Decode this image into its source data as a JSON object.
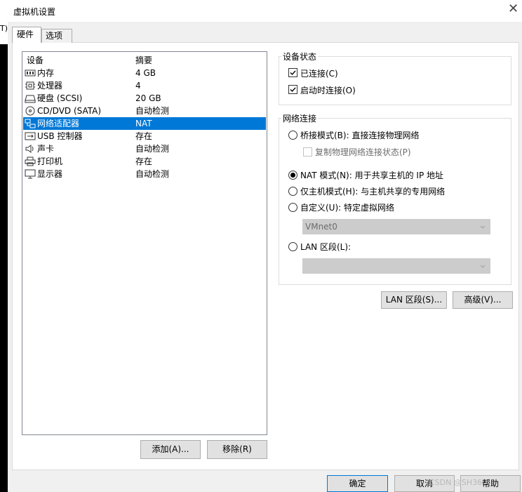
{
  "window": {
    "title": "虚拟机设置",
    "close_glyph": "✕",
    "edge_text": "T)"
  },
  "tabs": [
    {
      "label": "硬件",
      "active": true
    },
    {
      "label": "选项",
      "active": false
    }
  ],
  "device_list": {
    "header_device": "设备",
    "header_summary": "摘要",
    "rows": [
      {
        "name": "内存",
        "summary": "4 GB",
        "icon": "memory-icon",
        "selected": false
      },
      {
        "name": "处理器",
        "summary": "4",
        "icon": "cpu-icon",
        "selected": false
      },
      {
        "name": "硬盘 (SCSI)",
        "summary": "20 GB",
        "icon": "hard-disk-icon",
        "selected": false
      },
      {
        "name": "CD/DVD (SATA)",
        "summary": "自动检测",
        "icon": "cd-dvd-icon",
        "selected": false
      },
      {
        "name": "网络适配器",
        "summary": "NAT",
        "icon": "network-adapter-icon",
        "selected": true
      },
      {
        "name": "USB 控制器",
        "summary": "存在",
        "icon": "usb-icon",
        "selected": false
      },
      {
        "name": "声卡",
        "summary": "自动检测",
        "icon": "speaker-icon",
        "selected": false
      },
      {
        "name": "打印机",
        "summary": "存在",
        "icon": "printer-icon",
        "selected": false
      },
      {
        "name": "显示器",
        "summary": "自动检测",
        "icon": "monitor-icon",
        "selected": false
      }
    ]
  },
  "left_buttons": {
    "add": "添加(A)...",
    "remove": "移除(R)"
  },
  "device_status": {
    "title": "设备状态",
    "connected": {
      "label": "已连接(C)",
      "checked": true
    },
    "connect_at_power_on": {
      "label": "启动时连接(O)",
      "checked": true
    }
  },
  "network_connection": {
    "title": "网络连接",
    "bridged": {
      "label": "桥接模式(B): 直接连接物理网络",
      "selected": false
    },
    "replicate": {
      "label": "复制物理网络连接状态(P)",
      "checked": false,
      "disabled": true
    },
    "nat": {
      "label": "NAT 模式(N): 用于共享主机的 IP 地址",
      "selected": true
    },
    "host_only": {
      "label": "仅主机模式(H): 与主机共享的专用网络",
      "selected": false
    },
    "custom": {
      "label": "自定义(U): 特定虚拟网络",
      "selected": false
    },
    "custom_select_value": "VMnet0",
    "lan_segment": {
      "label": "LAN 区段(L):",
      "selected": false
    },
    "lan_select_value": ""
  },
  "right_buttons": {
    "lan_segments": "LAN 区段(S)...",
    "advanced": "高级(V)..."
  },
  "footer_buttons": {
    "ok": "确定",
    "cancel": "取消",
    "help": "帮助"
  },
  "watermark": "CSDN @SH36"
}
